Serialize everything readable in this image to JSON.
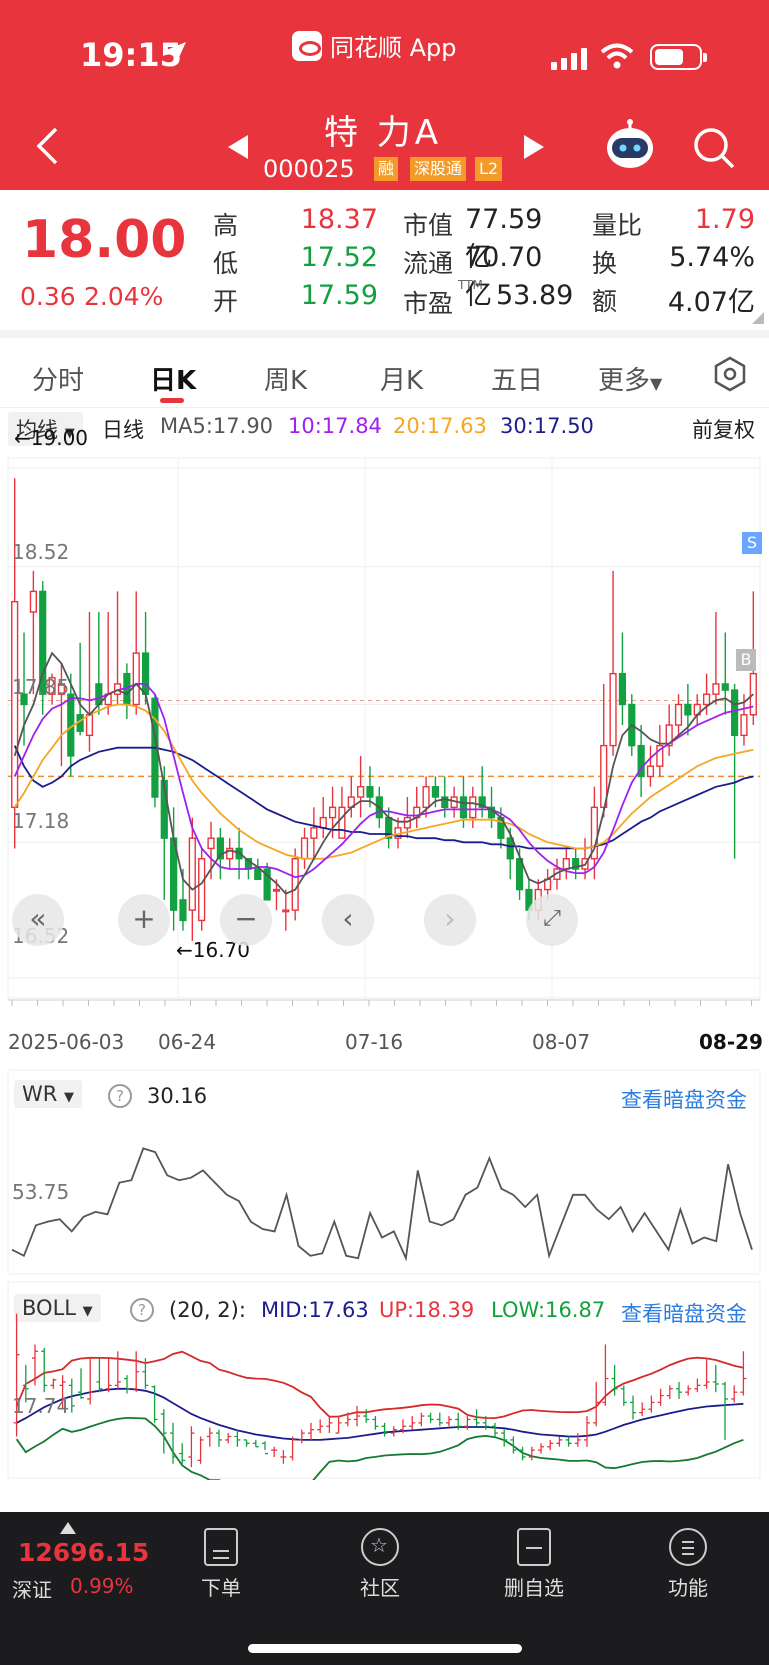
{
  "status_bar": {
    "time": "19:15",
    "app_label": "同花顺 App"
  },
  "header": {
    "name": "特 力A",
    "code": "000025",
    "tags": [
      "融",
      "深股通",
      "L2"
    ]
  },
  "quote": {
    "price": "18.00",
    "change": "0.36",
    "change_pct": "2.04%",
    "rows": [
      {
        "l1": "高",
        "v1": "18.37",
        "c1": "red",
        "l2": "市值",
        "v2": "77.59亿",
        "l3": "量比",
        "v3": "1.79",
        "c3": "red"
      },
      {
        "l1": "低",
        "v1": "17.52",
        "c1": "green",
        "l2": "流通",
        "v2": "70.70亿",
        "l3": "换",
        "v3": "5.74%",
        "c3": "dark"
      },
      {
        "l1": "开",
        "v1": "17.59",
        "c1": "green",
        "l2": "市盈",
        "v2": "53.89",
        "l3": "额",
        "v3": "4.07亿",
        "c3": "dark"
      }
    ],
    "ttm": "TTM"
  },
  "tabs": [
    "分时",
    "日K",
    "周K",
    "月K",
    "五日",
    "更多"
  ],
  "active_tab": "日K",
  "ma_bar": {
    "selector": "均线",
    "period": "日线",
    "ma5": "MA5:17.90",
    "ma10": "10:17.84",
    "ma20": "20:17.63",
    "ma30": "30:17.50",
    "adjust": "前复权"
  },
  "colors": {
    "up": "#e8343d",
    "down": "#13a040",
    "ma5": "#555555",
    "ma10": "#a020f0",
    "ma20": "#f5a623",
    "ma30": "#1c1c8c"
  },
  "kline": {
    "y_labels": [
      "19.00",
      "18.52",
      "17.85",
      "17.18",
      "16.52"
    ],
    "high_marker": "←19.00",
    "low_marker": "←16.70",
    "x_labels": [
      "2025-06-03",
      "06-24",
      "07-16",
      "08-07",
      "08-29"
    ],
    "markers": {
      "sell": "S",
      "buy": "B"
    }
  },
  "chart_data": [
    {
      "type": "candlestick",
      "title": "日K",
      "y_range": [
        16.52,
        19.0
      ],
      "candles": [
        [
          17.35,
          18.35,
          17.15,
          18.95
        ],
        [
          17.9,
          17.85,
          17.65,
          18.2
        ],
        [
          18.3,
          18.4,
          17.9,
          18.5
        ],
        [
          18.4,
          17.9,
          17.8,
          18.45
        ],
        [
          17.9,
          17.98,
          17.85,
          18.0
        ],
        [
          17.9,
          17.95,
          17.55,
          18.05
        ],
        [
          17.9,
          17.6,
          17.5,
          18.0
        ],
        [
          17.8,
          17.72,
          17.7,
          18.15
        ],
        [
          17.7,
          17.8,
          17.62,
          18.3
        ],
        [
          17.95,
          17.85,
          17.8,
          18.3
        ],
        [
          17.85,
          17.9,
          17.8,
          18.3
        ],
        [
          17.9,
          17.95,
          17.85,
          18.4
        ],
        [
          18.0,
          17.85,
          17.78,
          18.05
        ],
        [
          17.85,
          18.1,
          17.8,
          18.4
        ],
        [
          18.1,
          17.9,
          17.85,
          18.3
        ],
        [
          17.88,
          17.4,
          17.35,
          17.9
        ],
        [
          17.48,
          17.2,
          16.9,
          17.55
        ],
        [
          17.2,
          16.85,
          16.75,
          17.35
        ],
        [
          16.9,
          16.8,
          16.75,
          17.05
        ],
        [
          16.85,
          17.2,
          16.7,
          17.3
        ],
        [
          16.8,
          17.1,
          16.75,
          17.15
        ],
        [
          17.15,
          17.2,
          17.0,
          17.28
        ],
        [
          17.2,
          17.1,
          17.0,
          17.25
        ],
        [
          17.1,
          17.15,
          17.05,
          17.2
        ],
        [
          17.15,
          17.1,
          17.0,
          17.25
        ],
        [
          17.1,
          17.05,
          17.0,
          17.1
        ],
        [
          17.05,
          17.0,
          17.0,
          17.1
        ],
        [
          17.05,
          16.9,
          16.95,
          17.08
        ],
        [
          16.95,
          16.95,
          16.85,
          17.0
        ],
        [
          16.85,
          16.85,
          16.75,
          16.95
        ],
        [
          16.85,
          17.1,
          16.8,
          17.15
        ],
        [
          17.1,
          17.2,
          17.05,
          17.25
        ],
        [
          17.2,
          17.25,
          17.1,
          17.35
        ],
        [
          17.25,
          17.3,
          17.2,
          17.4
        ],
        [
          17.3,
          17.35,
          17.2,
          17.45
        ],
        [
          17.2,
          17.35,
          17.2,
          17.45
        ],
        [
          17.35,
          17.4,
          17.3,
          17.5
        ],
        [
          17.4,
          17.45,
          17.3,
          17.6
        ],
        [
          17.45,
          17.4,
          17.35,
          17.55
        ],
        [
          17.4,
          17.3,
          17.25,
          17.45
        ],
        [
          17.3,
          17.2,
          17.15,
          17.35
        ],
        [
          17.2,
          17.25,
          17.15,
          17.3
        ],
        [
          17.25,
          17.3,
          17.2,
          17.4
        ],
        [
          17.3,
          17.35,
          17.25,
          17.45
        ],
        [
          17.35,
          17.45,
          17.3,
          17.5
        ],
        [
          17.45,
          17.4,
          17.35,
          17.5
        ],
        [
          17.4,
          17.35,
          17.3,
          17.5
        ],
        [
          17.35,
          17.4,
          17.3,
          17.45
        ],
        [
          17.4,
          17.3,
          17.25,
          17.5
        ],
        [
          17.3,
          17.4,
          17.25,
          17.45
        ],
        [
          17.4,
          17.35,
          17.3,
          17.55
        ],
        [
          17.35,
          17.3,
          17.25,
          17.45
        ],
        [
          17.3,
          17.2,
          17.15,
          17.35
        ],
        [
          17.2,
          17.1,
          17.0,
          17.25
        ],
        [
          17.1,
          16.95,
          16.9,
          17.15
        ],
        [
          16.95,
          16.85,
          16.8,
          17.0
        ],
        [
          16.85,
          16.95,
          16.8,
          17.0
        ],
        [
          16.95,
          17.0,
          16.9,
          17.05
        ],
        [
          17.0,
          17.05,
          16.95,
          17.1
        ],
        [
          17.05,
          17.1,
          17.0,
          17.15
        ],
        [
          17.1,
          17.05,
          17.0,
          17.15
        ],
        [
          17.05,
          17.1,
          17.0,
          17.2
        ],
        [
          17.1,
          17.35,
          17.0,
          17.45
        ],
        [
          17.35,
          17.65,
          17.3,
          17.95
        ],
        [
          17.65,
          18.0,
          17.6,
          18.5
        ],
        [
          18.0,
          17.85,
          17.75,
          18.2
        ],
        [
          17.85,
          17.65,
          17.6,
          17.9
        ],
        [
          17.65,
          17.5,
          17.4,
          17.75
        ],
        [
          17.5,
          17.55,
          17.45,
          17.65
        ],
        [
          17.55,
          17.65,
          17.5,
          17.75
        ],
        [
          17.65,
          17.75,
          17.6,
          17.85
        ],
        [
          17.75,
          17.85,
          17.7,
          17.9
        ],
        [
          17.85,
          17.8,
          17.7,
          17.95
        ],
        [
          17.8,
          17.85,
          17.75,
          17.9
        ],
        [
          17.85,
          17.9,
          17.8,
          18.0
        ],
        [
          17.9,
          17.95,
          17.85,
          18.3
        ],
        [
          17.95,
          17.92,
          17.8,
          18.2
        ],
        [
          17.92,
          17.7,
          17.1,
          17.95
        ],
        [
          17.7,
          17.8,
          17.65,
          17.9
        ],
        [
          17.8,
          18.0,
          17.75,
          18.4
        ]
      ],
      "ma5": [
        17.6,
        17.75,
        17.85,
        18.0,
        18.1,
        18.05,
        17.95,
        17.85,
        17.8,
        17.85,
        17.9,
        17.92,
        17.9,
        17.95,
        17.9,
        17.7,
        17.45,
        17.2,
        17.0,
        16.95,
        16.98,
        17.05,
        17.12,
        17.14,
        17.13,
        17.09,
        17.06,
        17.02,
        16.98,
        16.93,
        16.95,
        17.02,
        17.1,
        17.18,
        17.25,
        17.3,
        17.35,
        17.38,
        17.38,
        17.35,
        17.3,
        17.28,
        17.28,
        17.3,
        17.34,
        17.38,
        17.39,
        17.38,
        17.37,
        17.37,
        17.36,
        17.34,
        17.3,
        17.22,
        17.11,
        17.0,
        16.98,
        17.0,
        17.03,
        17.05,
        17.06,
        17.07,
        17.15,
        17.33,
        17.55,
        17.7,
        17.75,
        17.72,
        17.68,
        17.66,
        17.66,
        17.7,
        17.74,
        17.8,
        17.84,
        17.87,
        17.88,
        17.85,
        17.86,
        17.9
      ],
      "ma10": [
        17.5,
        17.6,
        17.7,
        17.78,
        17.83,
        17.85,
        17.88,
        17.88,
        17.87,
        17.88,
        17.9,
        17.92,
        17.93,
        17.95,
        17.95,
        17.9,
        17.78,
        17.6,
        17.42,
        17.25,
        17.15,
        17.1,
        17.06,
        17.05,
        17.05,
        17.05,
        17.06,
        17.06,
        17.05,
        17.03,
        17.01,
        17.02,
        17.05,
        17.09,
        17.13,
        17.17,
        17.22,
        17.27,
        17.31,
        17.33,
        17.33,
        17.32,
        17.31,
        17.31,
        17.32,
        17.33,
        17.34,
        17.34,
        17.34,
        17.34,
        17.34,
        17.34,
        17.32,
        17.29,
        17.24,
        17.18,
        17.13,
        17.09,
        17.06,
        17.04,
        17.03,
        17.03,
        17.06,
        17.13,
        17.24,
        17.36,
        17.47,
        17.54,
        17.59,
        17.63,
        17.66,
        17.69,
        17.72,
        17.75,
        17.77,
        17.79,
        17.81,
        17.82,
        17.83,
        17.84
      ],
      "ma20": [
        17.35,
        17.42,
        17.5,
        17.58,
        17.64,
        17.7,
        17.74,
        17.77,
        17.8,
        17.82,
        17.84,
        17.85,
        17.85,
        17.84,
        17.82,
        17.78,
        17.72,
        17.64,
        17.56,
        17.48,
        17.42,
        17.37,
        17.32,
        17.28,
        17.24,
        17.21,
        17.18,
        17.16,
        17.14,
        17.12,
        17.11,
        17.1,
        17.1,
        17.1,
        17.11,
        17.12,
        17.13,
        17.15,
        17.17,
        17.19,
        17.21,
        17.22,
        17.23,
        17.24,
        17.25,
        17.26,
        17.27,
        17.28,
        17.29,
        17.29,
        17.29,
        17.29,
        17.28,
        17.27,
        17.25,
        17.22,
        17.2,
        17.18,
        17.17,
        17.16,
        17.15,
        17.15,
        17.16,
        17.18,
        17.22,
        17.27,
        17.32,
        17.36,
        17.4,
        17.43,
        17.46,
        17.49,
        17.52,
        17.55,
        17.57,
        17.59,
        17.6,
        17.61,
        17.62,
        17.63
      ],
      "ma30": [
        17.65,
        17.55,
        17.48,
        17.45,
        17.47,
        17.5,
        17.55,
        17.58,
        17.6,
        17.62,
        17.63,
        17.64,
        17.64,
        17.64,
        17.64,
        17.64,
        17.63,
        17.62,
        17.6,
        17.58,
        17.55,
        17.52,
        17.49,
        17.46,
        17.43,
        17.4,
        17.37,
        17.34,
        17.32,
        17.3,
        17.28,
        17.27,
        17.26,
        17.25,
        17.24,
        17.24,
        17.23,
        17.23,
        17.22,
        17.22,
        17.22,
        17.21,
        17.21,
        17.2,
        17.2,
        17.2,
        17.19,
        17.19,
        17.18,
        17.18,
        17.18,
        17.17,
        17.17,
        17.16,
        17.16,
        17.15,
        17.15,
        17.15,
        17.15,
        17.15,
        17.15,
        17.15,
        17.16,
        17.17,
        17.19,
        17.22,
        17.25,
        17.28,
        17.3,
        17.33,
        17.35,
        17.37,
        17.39,
        17.41,
        17.43,
        17.45,
        17.46,
        17.47,
        17.49,
        17.5
      ]
    },
    {
      "type": "line",
      "title": "WR",
      "value": "30.16",
      "y_label": "53.75",
      "values": [
        15,
        10,
        35,
        38,
        40,
        30,
        42,
        46,
        44,
        70,
        72,
        98,
        95,
        76,
        72,
        74,
        80,
        70,
        60,
        55,
        38,
        32,
        30,
        60,
        18,
        10,
        12,
        38,
        10,
        8,
        45,
        25,
        30,
        8,
        80,
        38,
        35,
        40,
        60,
        66,
        90,
        65,
        60,
        50,
        60,
        10,
        35,
        60,
        60,
        48,
        40,
        50,
        30,
        45,
        30,
        15,
        48,
        20,
        25,
        22,
        85,
        45,
        15
      ]
    },
    {
      "type": "line",
      "title": "BOLL",
      "params": "(20, 2):",
      "mid_label": "MID:17.63",
      "up_label": "UP:18.39",
      "low_label": "LOW:16.87",
      "y_label": "17.74"
    }
  ],
  "wr_header": {
    "selector": "WR",
    "value": "30.16",
    "link": "查看暗盘资金",
    "help": "?"
  },
  "boll_header": {
    "selector": "BOLL",
    "params": "(20, 2):",
    "mid": "MID:17.63",
    "up": "UP:18.39",
    "low": "LOW:16.87",
    "link": "查看暗盘资金",
    "help": "?"
  },
  "bottom": {
    "index_value": "12696.15",
    "index_name": "深证",
    "index_change": "0.99%",
    "nav": [
      "下单",
      "社区",
      "删自选",
      "功能"
    ]
  }
}
